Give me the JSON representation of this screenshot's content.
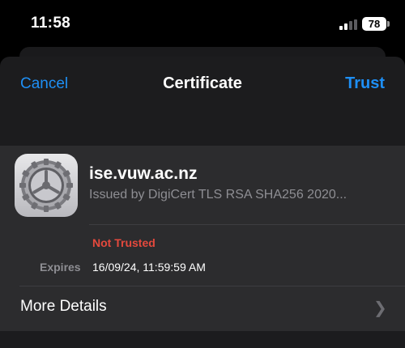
{
  "status_bar": {
    "time": "11:58",
    "battery": "78"
  },
  "nav": {
    "cancel": "Cancel",
    "title": "Certificate",
    "trust": "Trust"
  },
  "certificate": {
    "name": "ise.vuw.ac.nz",
    "issuer": "Issued by DigiCert TLS RSA SHA256 2020...",
    "status": "Not Trusted",
    "expires_label": "Expires",
    "expires_value": "16/09/24, 11:59:59 AM"
  },
  "more_details": {
    "label": "More Details"
  },
  "colors": {
    "accent": "#1e8ff5",
    "danger": "#e5493d"
  }
}
